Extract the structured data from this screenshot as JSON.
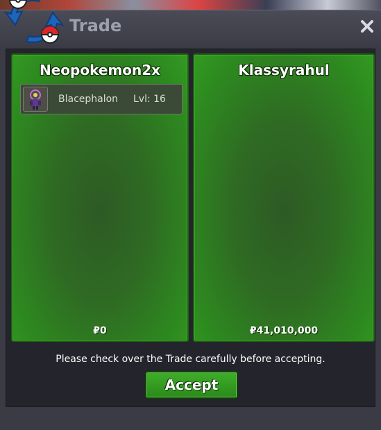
{
  "window": {
    "title": "Trade",
    "close_label": "close"
  },
  "trade": {
    "left": {
      "player": "Neopokemon2x",
      "items": [
        {
          "name": "Blacephalon",
          "level": "Lvl: 16",
          "icon": "blacephalon-sprite-icon"
        }
      ],
      "money": "0"
    },
    "right": {
      "player": "Klassyrahul",
      "items": [],
      "money": "41,010,000"
    }
  },
  "currency_symbol": "₽",
  "notice": "Please check over the Trade carefully before accepting.",
  "accept_label": "Accept",
  "colors": {
    "panel_green": "#2d8a1f",
    "window_bg": "#3a3b45",
    "title_text": "#9ea0ad"
  }
}
